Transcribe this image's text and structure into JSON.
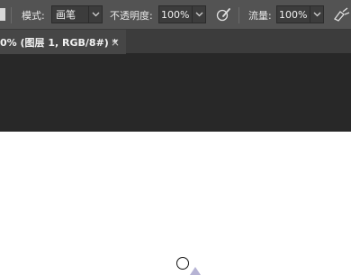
{
  "options_bar": {
    "mode_label": "模式:",
    "mode_value": "画笔",
    "opacity_label": "不透明度:",
    "opacity_value": "100%",
    "flow_label": "流量:",
    "flow_value": "100%",
    "icons": [
      "brush-tool-icon",
      "chevron-down-icon",
      "pressure-opacity-icon",
      "airbrush-icon"
    ]
  },
  "document": {
    "tab_title": "0% (图层 1, RGB/8#) *",
    "close_glyph": "×"
  },
  "colors": {
    "options_bg": "#535353",
    "tab_bg": "#464646",
    "pasteboard": "#282828",
    "canvas": "#ffffff"
  }
}
